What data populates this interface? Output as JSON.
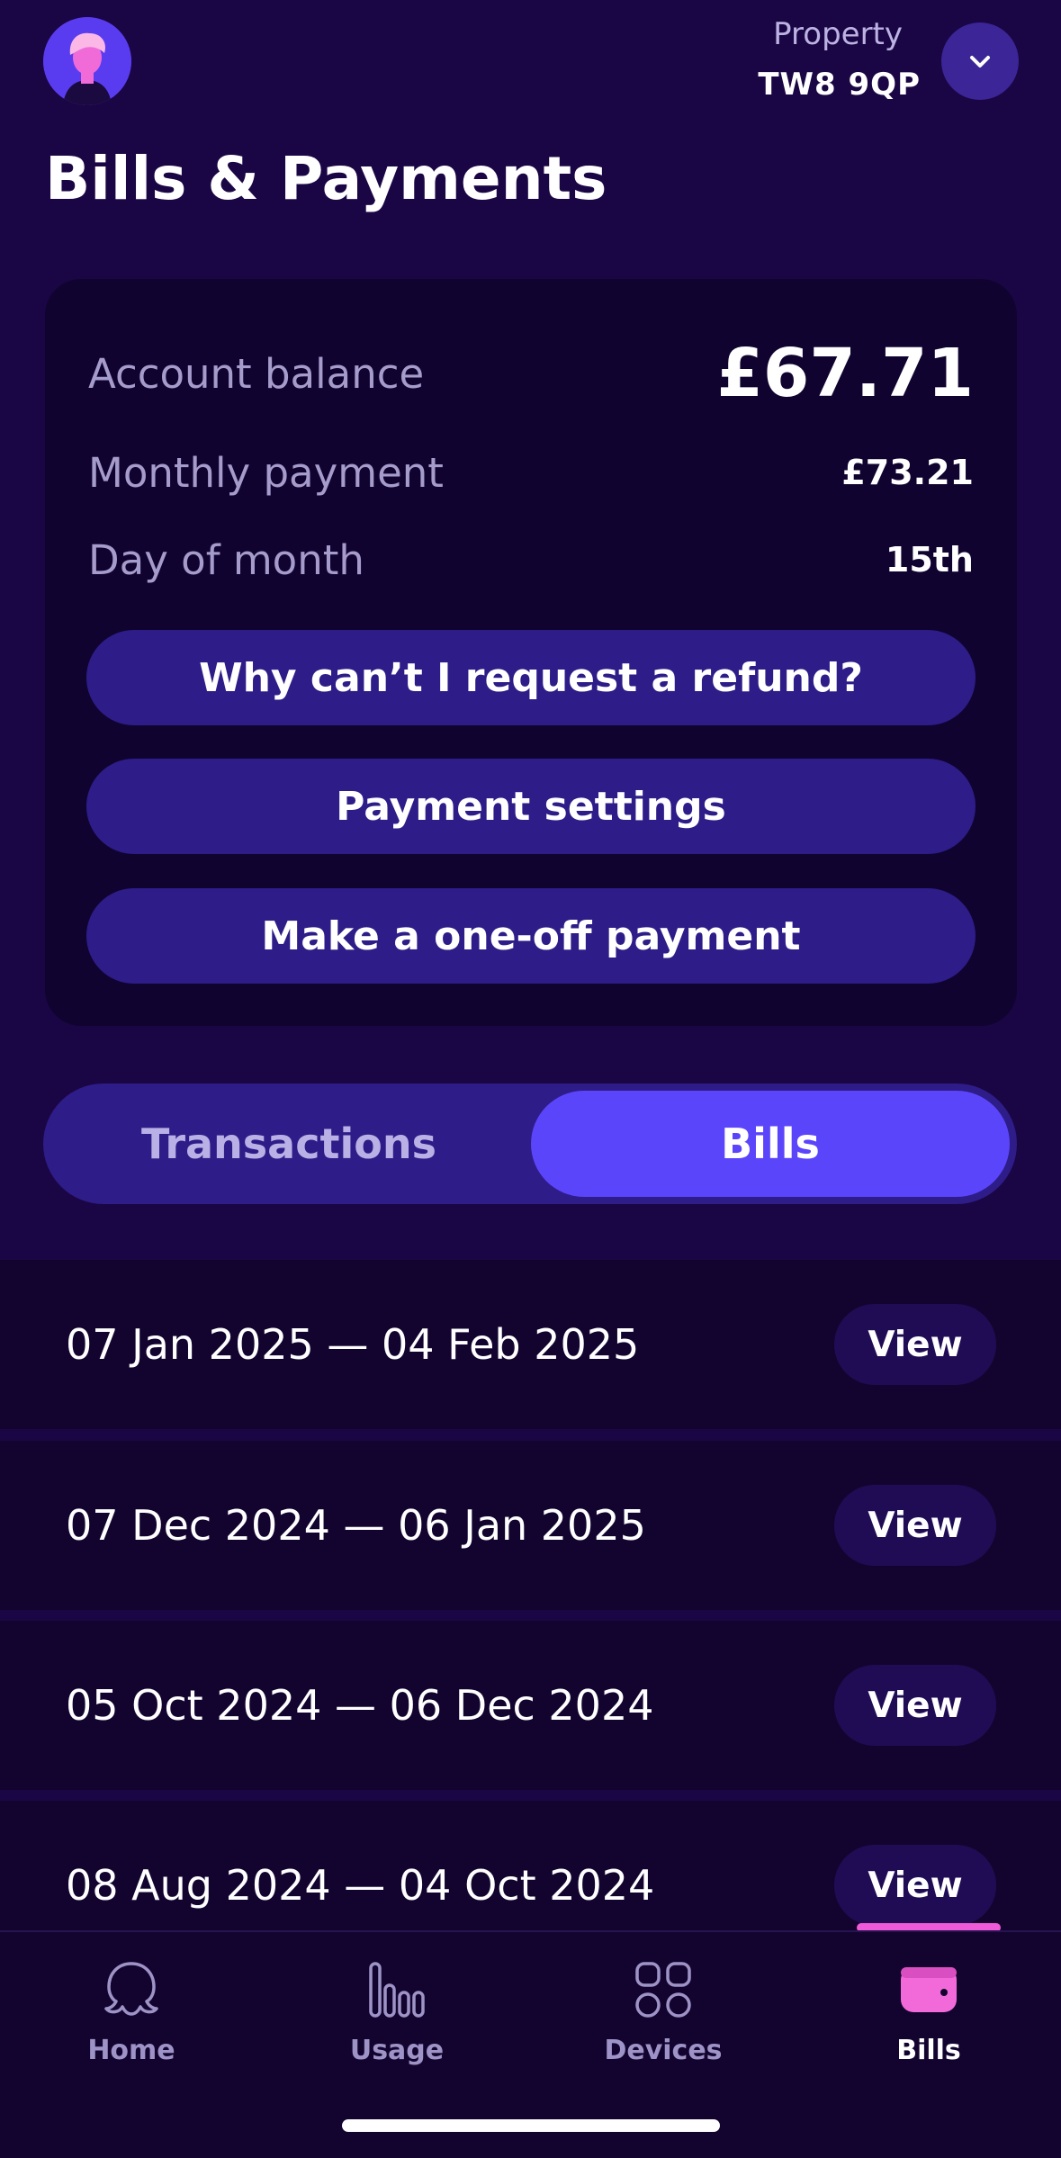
{
  "header": {
    "avatar_icon": "avatar-pink-character",
    "property_label": "Property",
    "property_value": "TW8 9QP",
    "dropdown_icon": "chevron-down-icon",
    "title": "Bills & Payments"
  },
  "balance_card": {
    "rows": [
      {
        "label": "Account balance",
        "value": "£67.71"
      },
      {
        "label": "Monthly payment",
        "value": "£73.21"
      },
      {
        "label": "Day of month",
        "value": "15th"
      }
    ],
    "buttons": {
      "refund": "Why can’t I request a refund?",
      "settings": "Payment settings",
      "one_off": "Make a one-off payment"
    }
  },
  "tabs": {
    "transactions": "Transactions",
    "bills": "Bills",
    "active": "Bills"
  },
  "bills": [
    {
      "period": "07 Jan 2025 — 04 Feb 2025",
      "action": "View"
    },
    {
      "period": "07 Dec 2024 — 06 Jan 2025",
      "action": "View"
    },
    {
      "period": "05 Oct 2024 — 06 Dec 2024",
      "action": "View"
    },
    {
      "period": "08 Aug 2024 — 04 Oct 2024",
      "action": "View"
    }
  ],
  "nav": {
    "items": [
      {
        "label": "Home",
        "icon": "octopus-icon"
      },
      {
        "label": "Usage",
        "icon": "bar-chart-icon"
      },
      {
        "label": "Devices",
        "icon": "devices-grid-icon"
      },
      {
        "label": "Bills",
        "icon": "wallet-icon"
      }
    ],
    "active": "Bills"
  },
  "colors": {
    "background": "#1a0644",
    "card": "#100330",
    "button": "#2e1c88",
    "accent": "#5b45fb",
    "highlight": "#ef5ad8"
  }
}
